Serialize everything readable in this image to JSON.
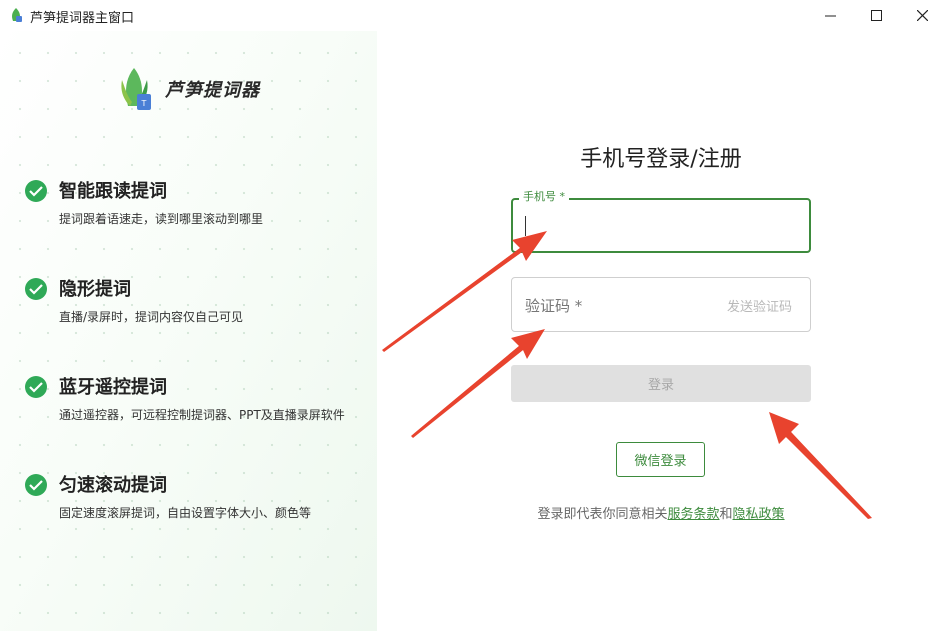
{
  "window": {
    "title": "芦笋提词器主窗口",
    "controls": [
      "minimize",
      "maximize",
      "close"
    ]
  },
  "brand": {
    "name": "芦笋提词器",
    "logo_badge": "T"
  },
  "features": [
    {
      "title": "智能跟读提词",
      "desc": "提词跟着语速走，读到哪里滚动到哪里"
    },
    {
      "title": "隐形提词",
      "desc": "直播/录屏时，提词内容仅自己可见"
    },
    {
      "title": "蓝牙遥控提词",
      "desc": "通过遥控器，可远程控制提词器、PPT及直播录屏软件"
    },
    {
      "title": "匀速滚动提词",
      "desc": "固定速度滚屏提词，自由设置字体大小、颜色等"
    }
  ],
  "form": {
    "title": "手机号登录/注册",
    "phone": {
      "label": "手机号 *",
      "value": ""
    },
    "code": {
      "placeholder": "验证码 *",
      "send_label": "发送验证码"
    },
    "login_label": "登录",
    "wechat_label": "微信登录",
    "agreement": {
      "prefix": "登录即代表你同意相关",
      "terms": "服务条款",
      "and": "和",
      "privacy": "隐私政策"
    }
  },
  "colors": {
    "accent": "#3d8b3d",
    "check": "#2fa957",
    "annotation_arrow": "#e8432e",
    "disabled_button": "#e0e0e0"
  }
}
